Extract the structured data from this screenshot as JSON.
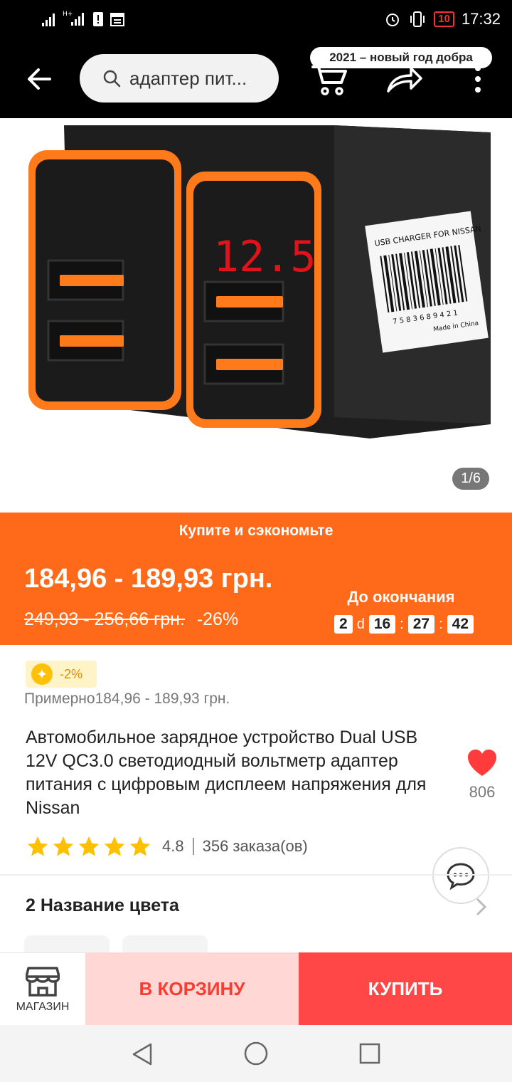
{
  "status_bar": {
    "time": "17:32",
    "battery": "10",
    "network": "H+"
  },
  "header": {
    "search_text": "адаптер пит...",
    "icons": [
      "back-arrow-icon",
      "search-icon",
      "cart-icon",
      "share-icon",
      "more-vert-icon"
    ]
  },
  "gallery": {
    "counter": "1/6",
    "image_label": "USB CHARGER FOR NISSAN",
    "voltage_display": "12.5",
    "barcode_digits": "7 5 8 3 6 8 9 4 2 1",
    "made_in": "Made in China"
  },
  "promo": {
    "title": "Купите и сэкономьте",
    "price": "184,96 - 189,93 грн.",
    "old_price": "249,93 - 256,66 грн.",
    "discount": "-26%",
    "event_badge": "2021 – новый год добра",
    "until_label": "До окончания",
    "timer": {
      "days": "2",
      "days_unit": "d",
      "hours": "16",
      "minutes": "27",
      "seconds": "42"
    },
    "colors": {
      "background": "#ff6a1a"
    }
  },
  "info": {
    "coin_discount": "-2%",
    "approx_price": "Примерно184,96 - 189,93 грн.",
    "title": "Автомобильное зарядное устройство Dual USB 12V QC3.0 светодиодный вольтметр адаптер питания с цифровым дисплеем напряжения для Nissan",
    "favorites_count": "806",
    "rating": "4.8",
    "rating_stars": 5,
    "orders": "356 заказа(ов)"
  },
  "variants": {
    "section_title": "2 Название цвета"
  },
  "bottom_bar": {
    "store_label": "МАГАЗИН",
    "add_to_cart": "В КОРЗИНУ",
    "buy_now": "КУПИТЬ",
    "colors": {
      "cart_bg": "#ffd7d5",
      "buy_bg": "#ff4747"
    }
  }
}
